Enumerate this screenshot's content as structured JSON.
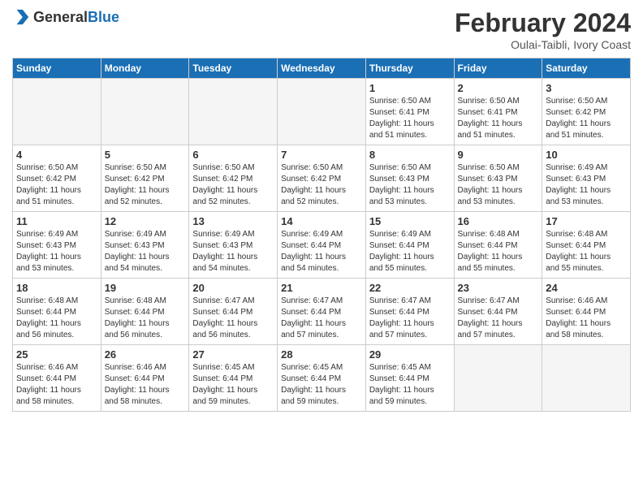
{
  "header": {
    "logo_general": "General",
    "logo_blue": "Blue",
    "month_year": "February 2024",
    "location": "Oulai-Taibli, Ivory Coast"
  },
  "weekdays": [
    "Sunday",
    "Monday",
    "Tuesday",
    "Wednesday",
    "Thursday",
    "Friday",
    "Saturday"
  ],
  "weeks": [
    [
      {
        "day": "",
        "info": ""
      },
      {
        "day": "",
        "info": ""
      },
      {
        "day": "",
        "info": ""
      },
      {
        "day": "",
        "info": ""
      },
      {
        "day": "1",
        "info": "Sunrise: 6:50 AM\nSunset: 6:41 PM\nDaylight: 11 hours\nand 51 minutes."
      },
      {
        "day": "2",
        "info": "Sunrise: 6:50 AM\nSunset: 6:41 PM\nDaylight: 11 hours\nand 51 minutes."
      },
      {
        "day": "3",
        "info": "Sunrise: 6:50 AM\nSunset: 6:42 PM\nDaylight: 11 hours\nand 51 minutes."
      }
    ],
    [
      {
        "day": "4",
        "info": "Sunrise: 6:50 AM\nSunset: 6:42 PM\nDaylight: 11 hours\nand 51 minutes."
      },
      {
        "day": "5",
        "info": "Sunrise: 6:50 AM\nSunset: 6:42 PM\nDaylight: 11 hours\nand 52 minutes."
      },
      {
        "day": "6",
        "info": "Sunrise: 6:50 AM\nSunset: 6:42 PM\nDaylight: 11 hours\nand 52 minutes."
      },
      {
        "day": "7",
        "info": "Sunrise: 6:50 AM\nSunset: 6:42 PM\nDaylight: 11 hours\nand 52 minutes."
      },
      {
        "day": "8",
        "info": "Sunrise: 6:50 AM\nSunset: 6:43 PM\nDaylight: 11 hours\nand 53 minutes."
      },
      {
        "day": "9",
        "info": "Sunrise: 6:50 AM\nSunset: 6:43 PM\nDaylight: 11 hours\nand 53 minutes."
      },
      {
        "day": "10",
        "info": "Sunrise: 6:49 AM\nSunset: 6:43 PM\nDaylight: 11 hours\nand 53 minutes."
      }
    ],
    [
      {
        "day": "11",
        "info": "Sunrise: 6:49 AM\nSunset: 6:43 PM\nDaylight: 11 hours\nand 53 minutes."
      },
      {
        "day": "12",
        "info": "Sunrise: 6:49 AM\nSunset: 6:43 PM\nDaylight: 11 hours\nand 54 minutes."
      },
      {
        "day": "13",
        "info": "Sunrise: 6:49 AM\nSunset: 6:43 PM\nDaylight: 11 hours\nand 54 minutes."
      },
      {
        "day": "14",
        "info": "Sunrise: 6:49 AM\nSunset: 6:44 PM\nDaylight: 11 hours\nand 54 minutes."
      },
      {
        "day": "15",
        "info": "Sunrise: 6:49 AM\nSunset: 6:44 PM\nDaylight: 11 hours\nand 55 minutes."
      },
      {
        "day": "16",
        "info": "Sunrise: 6:48 AM\nSunset: 6:44 PM\nDaylight: 11 hours\nand 55 minutes."
      },
      {
        "day": "17",
        "info": "Sunrise: 6:48 AM\nSunset: 6:44 PM\nDaylight: 11 hours\nand 55 minutes."
      }
    ],
    [
      {
        "day": "18",
        "info": "Sunrise: 6:48 AM\nSunset: 6:44 PM\nDaylight: 11 hours\nand 56 minutes."
      },
      {
        "day": "19",
        "info": "Sunrise: 6:48 AM\nSunset: 6:44 PM\nDaylight: 11 hours\nand 56 minutes."
      },
      {
        "day": "20",
        "info": "Sunrise: 6:47 AM\nSunset: 6:44 PM\nDaylight: 11 hours\nand 56 minutes."
      },
      {
        "day": "21",
        "info": "Sunrise: 6:47 AM\nSunset: 6:44 PM\nDaylight: 11 hours\nand 57 minutes."
      },
      {
        "day": "22",
        "info": "Sunrise: 6:47 AM\nSunset: 6:44 PM\nDaylight: 11 hours\nand 57 minutes."
      },
      {
        "day": "23",
        "info": "Sunrise: 6:47 AM\nSunset: 6:44 PM\nDaylight: 11 hours\nand 57 minutes."
      },
      {
        "day": "24",
        "info": "Sunrise: 6:46 AM\nSunset: 6:44 PM\nDaylight: 11 hours\nand 58 minutes."
      }
    ],
    [
      {
        "day": "25",
        "info": "Sunrise: 6:46 AM\nSunset: 6:44 PM\nDaylight: 11 hours\nand 58 minutes."
      },
      {
        "day": "26",
        "info": "Sunrise: 6:46 AM\nSunset: 6:44 PM\nDaylight: 11 hours\nand 58 minutes."
      },
      {
        "day": "27",
        "info": "Sunrise: 6:45 AM\nSunset: 6:44 PM\nDaylight: 11 hours\nand 59 minutes."
      },
      {
        "day": "28",
        "info": "Sunrise: 6:45 AM\nSunset: 6:44 PM\nDaylight: 11 hours\nand 59 minutes."
      },
      {
        "day": "29",
        "info": "Sunrise: 6:45 AM\nSunset: 6:44 PM\nDaylight: 11 hours\nand 59 minutes."
      },
      {
        "day": "",
        "info": ""
      },
      {
        "day": "",
        "info": ""
      }
    ]
  ]
}
